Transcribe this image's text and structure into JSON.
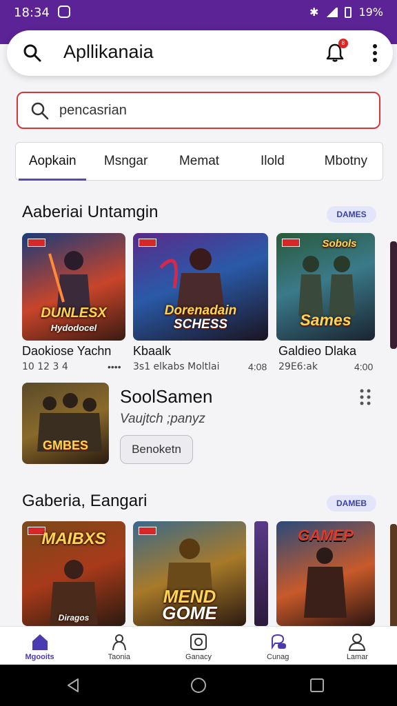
{
  "status_bar": {
    "time": "18:34",
    "battery": "19%"
  },
  "app_bar": {
    "title": "Apllikanaia",
    "notification_count": "8"
  },
  "search": {
    "placeholder": "pencasrian"
  },
  "tabs": [
    {
      "label": "Aopkain",
      "active": true
    },
    {
      "label": "Msngar",
      "active": false
    },
    {
      "label": "Memat",
      "active": false
    },
    {
      "label": "Ilold",
      "active": false
    },
    {
      "label": "Mbotny",
      "active": false
    }
  ],
  "section1": {
    "title": "Aaberiai Untamgin",
    "pill": "DAMES",
    "cards": [
      {
        "art_text": "DUNLESX",
        "art_sub": "Hydodocel",
        "name": "Daokiose Yachn",
        "meta": "10 12 3 4",
        "more": "••••"
      },
      {
        "art_text": "Dorenadain",
        "art_sub": "SCHESS",
        "name": "Kbaalk",
        "meta": "3s1 elkabs Moltlai",
        "more": "4:08"
      },
      {
        "art_text": "Sames",
        "art_sub": "Sobols",
        "name": "Galdieo Dlaka",
        "meta": "29E6:ak",
        "more": "4:00"
      }
    ]
  },
  "featured": {
    "art_text": "GMBES",
    "name": "SoolSamen",
    "subtitle": "Vaujtch ;panyz",
    "button": "Benoketn"
  },
  "section2": {
    "title": "Gaberia, Eangari",
    "pill": "DAMEB",
    "cards": [
      {
        "art_text": "MAIBXS",
        "art_sub": "Diragos"
      },
      {
        "art_text": "MEND",
        "art_sub": "GOME"
      },
      {
        "art_text": "GAMEP",
        "art_sub": ""
      }
    ]
  },
  "bottom_nav": [
    {
      "label": "Mgooits",
      "icon": "home-icon",
      "active": true
    },
    {
      "label": "Taonia",
      "icon": "person-outline-icon",
      "active": false
    },
    {
      "label": "Ganacy",
      "icon": "camera-icon",
      "active": false
    },
    {
      "label": "Cunag",
      "icon": "chat-icon",
      "active": false
    },
    {
      "label": "Lamar",
      "icon": "profile-icon",
      "active": false
    }
  ],
  "colors": {
    "status_bar": "#5b2396",
    "accent": "#5a46b8",
    "search_border": "#d23737",
    "pill_bg": "#e3e5fb",
    "pill_text": "#3942a8"
  }
}
